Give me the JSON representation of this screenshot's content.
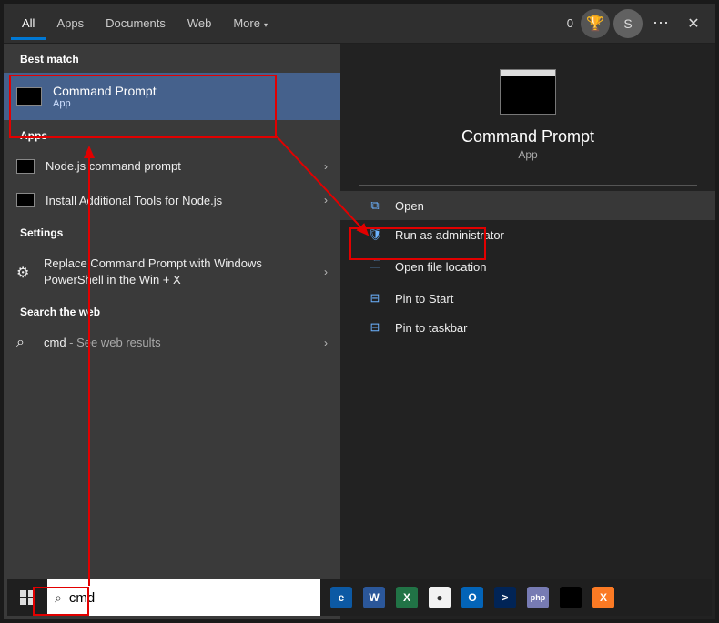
{
  "topbar": {
    "tabs": [
      "All",
      "Apps",
      "Documents",
      "Web",
      "More"
    ],
    "badge_count": "0",
    "avatar_initial": "S"
  },
  "left": {
    "best_match_label": "Best match",
    "best": {
      "title": "Command Prompt",
      "subtitle": "App"
    },
    "apps_label": "Apps",
    "apps": [
      {
        "label": "Node.js command prompt"
      },
      {
        "label": "Install Additional Tools for Node.js"
      }
    ],
    "settings_label": "Settings",
    "settings": [
      {
        "label": "Replace Command Prompt with Windows PowerShell in the Win + X"
      }
    ],
    "web_label": "Search the web",
    "web": [
      {
        "label": "cmd",
        "sublabel": " - See web results"
      }
    ]
  },
  "right": {
    "title": "Command Prompt",
    "subtitle": "App",
    "actions": [
      {
        "icon": "⧉",
        "label": "Open"
      },
      {
        "icon": "🛡",
        "label": "Run as administrator"
      },
      {
        "icon": "🗀",
        "label": "Open file location"
      },
      {
        "icon": "⊟",
        "label": "Pin to Start"
      },
      {
        "icon": "⊟",
        "label": "Pin to taskbar"
      }
    ]
  },
  "search": {
    "value": "cmd"
  },
  "taskbar": [
    {
      "name": "edge",
      "bg": "#0c59a4",
      "text": "e"
    },
    {
      "name": "word",
      "bg": "#2b579a",
      "text": "W"
    },
    {
      "name": "excel",
      "bg": "#217346",
      "text": "X"
    },
    {
      "name": "chrome",
      "bg": "#f2f2f2",
      "text": "●"
    },
    {
      "name": "outlook",
      "bg": "#0364b8",
      "text": "O"
    },
    {
      "name": "powershell",
      "bg": "#012456",
      "text": ">"
    },
    {
      "name": "php",
      "bg": "#777bb3",
      "text": "php"
    },
    {
      "name": "cmd",
      "bg": "#000",
      "text": ""
    },
    {
      "name": "xampp",
      "bg": "#fb7a24",
      "text": "X"
    }
  ]
}
